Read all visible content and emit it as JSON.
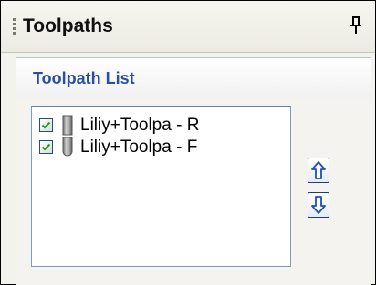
{
  "panel": {
    "title": "Toolpaths",
    "grip_icon": "gripper-icon",
    "pin_icon": "pin-icon"
  },
  "toolpath_list": {
    "title": "Toolpath List",
    "items": [
      {
        "label": "Liliy+Toolpa - R",
        "checked": true,
        "icon": "flat-endmill-icon"
      },
      {
        "label": "Liliy+Toolpa - F",
        "checked": true,
        "icon": "ballnose-endmill-icon"
      }
    ],
    "move_up_icon": "arrow-up-icon",
    "move_down_icon": "arrow-down-icon"
  },
  "colors": {
    "section_title": "#2a4ea6",
    "button_arrow": "#1f4fb0",
    "checkmark": "#21a121"
  }
}
